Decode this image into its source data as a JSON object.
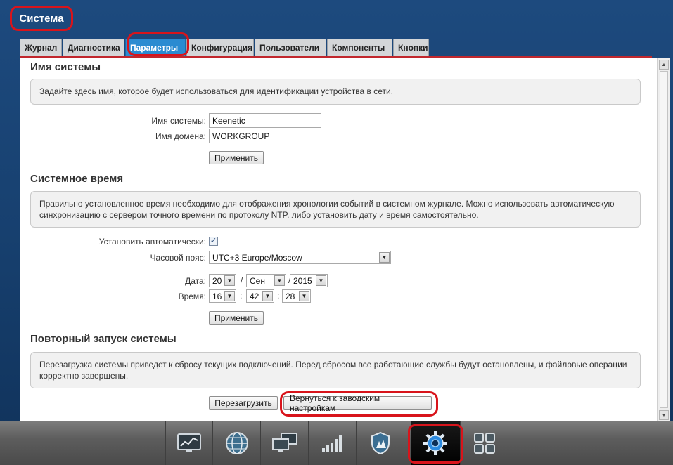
{
  "header": {
    "title": "Система"
  },
  "tabs": [
    {
      "label": "Журнал",
      "active": false
    },
    {
      "label": "Диагностика",
      "active": false
    },
    {
      "label": "Параметры",
      "active": true
    },
    {
      "label": "Конфигурация",
      "active": false
    },
    {
      "label": "Пользователи",
      "active": false
    },
    {
      "label": "Компоненты",
      "active": false
    },
    {
      "label": "Кнопки",
      "active": false
    }
  ],
  "system_name": {
    "title": "Имя системы",
    "description": "Задайте здесь имя, которое будет использоваться для идентификации устройства в сети.",
    "name_label": "Имя системы:",
    "name_value": "Keenetic",
    "domain_label": "Имя домена:",
    "domain_value": "WORKGROUP",
    "apply_label": "Применить"
  },
  "system_time": {
    "title": "Системное время",
    "description": "Правильно установленное время необходимо для отображения хронологии событий в системном журнале. Можно использовать автоматическую синхронизацию с сервером точного времени по протоколу NTP. либо установить дату и время самостоятельно.",
    "auto_label": "Установить автоматически:",
    "auto_checked": true,
    "tz_label": "Часовой пояс:",
    "tz_value": "UTC+3 Europe/Moscow",
    "date_label": "Дата:",
    "day": "20",
    "month": "Сен",
    "year": "2015",
    "date_sep": "/",
    "time_label": "Время:",
    "hour": "16",
    "minute": "42",
    "second": "28",
    "time_sep": ":",
    "apply_label": "Применить"
  },
  "restart": {
    "title": "Повторный запуск системы",
    "description": "Перезагрузка системы приведет к сбросу текущих подключений. Перед сбросом все работающие службы будут остановлены, и файловые операции корректно завершены.",
    "reboot_label": "Перезагрузить",
    "factory_reset_label": "Вернуться к заводским настройкам"
  },
  "bottom_nav": [
    {
      "icon": "monitor-chart-icon",
      "active": false
    },
    {
      "icon": "globe-icon",
      "active": false
    },
    {
      "icon": "network-computers-icon",
      "active": false
    },
    {
      "icon": "signal-bars-icon",
      "active": false
    },
    {
      "icon": "shield-icon",
      "active": false
    },
    {
      "icon": "gear-icon",
      "active": true
    },
    {
      "icon": "apps-grid-icon",
      "active": false
    }
  ],
  "colors": {
    "background": "#1d4a7e",
    "highlight": "#d8141b",
    "active_tab": "#2a8bd1",
    "tab_underline": "#c1272d"
  }
}
